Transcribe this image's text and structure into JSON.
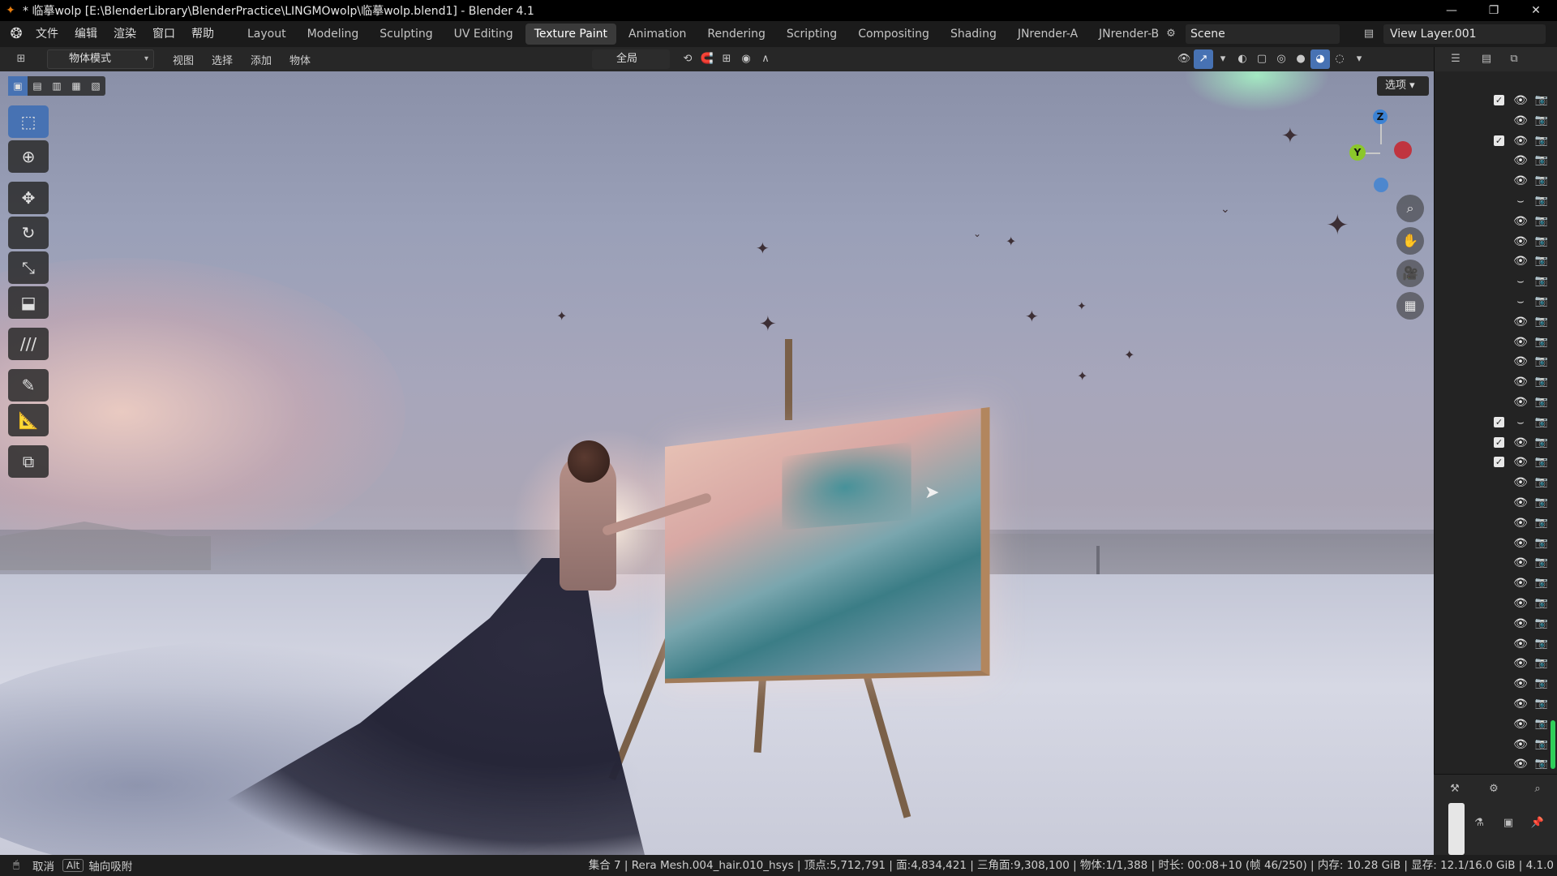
{
  "window": {
    "title": "* 临摹wolp [E:\\BlenderLibrary\\BlenderPractice\\LINGMOwolp\\临摹wolp.blend1] - Blender 4.1",
    "minimize": "—",
    "maximize": "❐",
    "close": "✕"
  },
  "menu": {
    "items": [
      "文件",
      "编辑",
      "渲染",
      "窗口",
      "帮助"
    ]
  },
  "workspaces": [
    {
      "label": "Layout"
    },
    {
      "label": "Modeling"
    },
    {
      "label": "Sculpting"
    },
    {
      "label": "UV Editing"
    },
    {
      "label": "Texture Paint",
      "active": true
    },
    {
      "label": "Animation"
    },
    {
      "label": "Rendering"
    },
    {
      "label": "Scripting"
    },
    {
      "label": "Compositing"
    },
    {
      "label": "Shading"
    },
    {
      "label": "JNrender-A"
    },
    {
      "label": "JNrender-B"
    }
  ],
  "scene": {
    "name": "Scene"
  },
  "view_layer": {
    "name": "View Layer.001"
  },
  "viewport_header": {
    "mode": "物体模式",
    "menus": [
      "视图",
      "选择",
      "添加",
      "物体"
    ],
    "transform_orientation": "全局",
    "options_label": "选项"
  },
  "toolbar": {
    "tools": [
      {
        "name": "select-box-tool",
        "glyph": "⬚",
        "active": true
      },
      {
        "name": "cursor-tool",
        "glyph": "⊕"
      },
      {
        "name": "move-tool",
        "glyph": "✥"
      },
      {
        "name": "rotate-tool",
        "glyph": "↻"
      },
      {
        "name": "scale-tool",
        "glyph": "⤡"
      },
      {
        "name": "transform-tool",
        "glyph": "⬓"
      },
      {
        "name": "annotate-tool",
        "glyph": "///"
      },
      {
        "name": "draw-tool",
        "glyph": "✎"
      },
      {
        "name": "measure-tool",
        "glyph": "📐"
      },
      {
        "name": "add-cube-tool",
        "glyph": "⧉"
      }
    ]
  },
  "gizmo": {
    "x_label": "",
    "y_label": "Y",
    "z_label": "Z"
  },
  "outliner": {
    "rows": [
      {
        "check": true,
        "eye": true
      },
      {
        "check": false,
        "eye": true
      },
      {
        "check": true,
        "eye": true
      },
      {
        "check": false,
        "eye": true
      },
      {
        "check": false,
        "eye": true
      },
      {
        "check": false,
        "eye": false
      },
      {
        "check": false,
        "eye": true
      },
      {
        "check": false,
        "eye": true
      },
      {
        "check": false,
        "eye": true
      },
      {
        "check": false,
        "eye": false
      },
      {
        "check": false,
        "eye": false
      },
      {
        "check": false,
        "eye": true
      },
      {
        "check": false,
        "eye": true
      },
      {
        "check": false,
        "eye": true
      },
      {
        "check": false,
        "eye": true
      },
      {
        "check": false,
        "eye": true
      },
      {
        "check": true,
        "eye": false
      },
      {
        "check": true,
        "eye": true
      },
      {
        "check": true,
        "eye": true
      },
      {
        "check": false,
        "eye": true
      },
      {
        "check": false,
        "eye": true
      },
      {
        "check": false,
        "eye": true
      },
      {
        "check": false,
        "eye": true
      },
      {
        "check": false,
        "eye": true
      },
      {
        "check": false,
        "eye": true
      },
      {
        "check": false,
        "eye": true
      },
      {
        "check": false,
        "eye": true
      },
      {
        "check": false,
        "eye": true
      },
      {
        "check": false,
        "eye": true
      },
      {
        "check": false,
        "eye": true
      },
      {
        "check": false,
        "eye": true
      },
      {
        "check": false,
        "eye": true
      },
      {
        "check": false,
        "eye": true
      },
      {
        "check": false,
        "eye": true
      }
    ]
  },
  "status_bar": {
    "left_action": "取消",
    "key": "Alt",
    "key_action": "轴向吸附",
    "stats": "集合 7 | Rera Mesh.004_hair.010_hsys | 顶点:5,712,791 | 面:4,834,421 | 三角面:9,308,100 | 物体:1/1,388 | 时长: 00:08+10 (帧 46/250) | 内存: 10.28 GiB | 显存: 12.1/16.0 GiB | 4.1.0"
  },
  "colors": {
    "accent": "#4772b3",
    "x_axis": "#c0343f",
    "y_axis": "#8bc72b",
    "z_axis": "#3b82d4"
  }
}
